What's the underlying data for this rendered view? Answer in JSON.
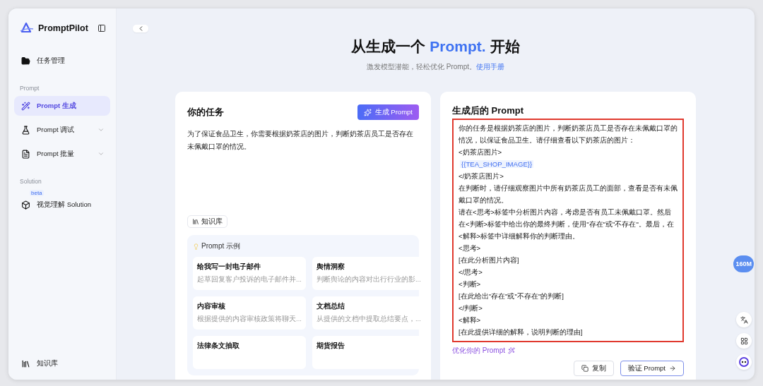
{
  "sidebar": {
    "brand": "PromptPilot",
    "sections": [
      {
        "items": [
          {
            "label": "任务管理",
            "selected": false,
            "expandable": false
          }
        ]
      },
      {
        "heading": "Prompt",
        "items": [
          {
            "label": "Prompt 生成",
            "selected": true,
            "expandable": false
          },
          {
            "label": "Prompt 调试",
            "selected": false,
            "expandable": true
          },
          {
            "label": "Prompt 批量",
            "selected": false,
            "expandable": true
          }
        ]
      },
      {
        "heading": "Solution",
        "items": [
          {
            "label": "视觉理解 Solution",
            "selected": false,
            "expandable": false,
            "badge": "beta"
          }
        ]
      }
    ],
    "footer": {
      "label": "知识库"
    }
  },
  "header": {
    "title_before": "从生成一个 ",
    "title_highlight": "Prompt.",
    "title_after": " 开始",
    "subtitle": "激发模型潜能，轻松优化 Prompt。",
    "subtitle_link": "使用手册"
  },
  "task_card": {
    "title": "你的任务",
    "generate_button": "生成 Prompt",
    "task_text": "为了保证食品卫生，你需要根据奶茶店的图片，判断奶茶店员工是否存在未佩戴口罩的情况。",
    "knowledge_chip": "知识库",
    "examples": {
      "heading": "Prompt 示例",
      "items": [
        {
          "title": "给我写一封电子邮件",
          "description": "起草回复客户投诉的电子邮件并..."
        },
        {
          "title": "舆情洞察",
          "description": "判断舆论的内容对出行行业的影..."
        },
        {
          "title": "内容审核",
          "description": "根据提供的内容审核政策将聊天..."
        },
        {
          "title": "文档总结",
          "description": "从提供的文档中提取总结要点，..."
        },
        {
          "title": "法律条文抽取"
        },
        {
          "title": "期货报告"
        }
      ]
    }
  },
  "result_card": {
    "title": "生成后的 Prompt",
    "lines": [
      {
        "kind": "text",
        "text": "你的任务是根据奶茶店的图片，判断奶茶店员工是否存在未佩戴口罩的情况，以保证食品卫生。请仔细查看以下奶茶店的图片："
      },
      {
        "kind": "text",
        "text": "<奶茶店图片>"
      },
      {
        "kind": "variable",
        "text": "{{TEA_SHOP_IMAGE}}"
      },
      {
        "kind": "text",
        "text": "</奶茶店图片>"
      },
      {
        "kind": "text",
        "text": "在判断时，请仔细观察图片中所有奶茶店员工的面部，查看是否有未佩戴口罩的情况。"
      },
      {
        "kind": "text",
        "text": "请在<思考>标签中分析图片内容，考虑是否有员工未佩戴口罩。然后在<判断>标签中给出你的最终判断，使用\"存在\"或\"不存在\"。最后，在<解释>标签中详细解释你的判断理由。"
      },
      {
        "kind": "text",
        "text": "<思考>"
      },
      {
        "kind": "text",
        "text": "[在此分析图片内容]"
      },
      {
        "kind": "text",
        "text": "</思考>"
      },
      {
        "kind": "text",
        "text": "<判断>"
      },
      {
        "kind": "text",
        "text": "[在此给出\"存在\"或\"不存在\"的判断]"
      },
      {
        "kind": "text",
        "text": "</判断>"
      },
      {
        "kind": "text",
        "text": "<解释>"
      },
      {
        "kind": "text",
        "text": "[在此提供详细的解释，说明判断的理由]"
      }
    ],
    "optimize_link": "优化你的 Prompt",
    "copy_button": "复制",
    "verify_button": "验证 Prompt"
  },
  "floating": {
    "memory_badge": "160M"
  }
}
